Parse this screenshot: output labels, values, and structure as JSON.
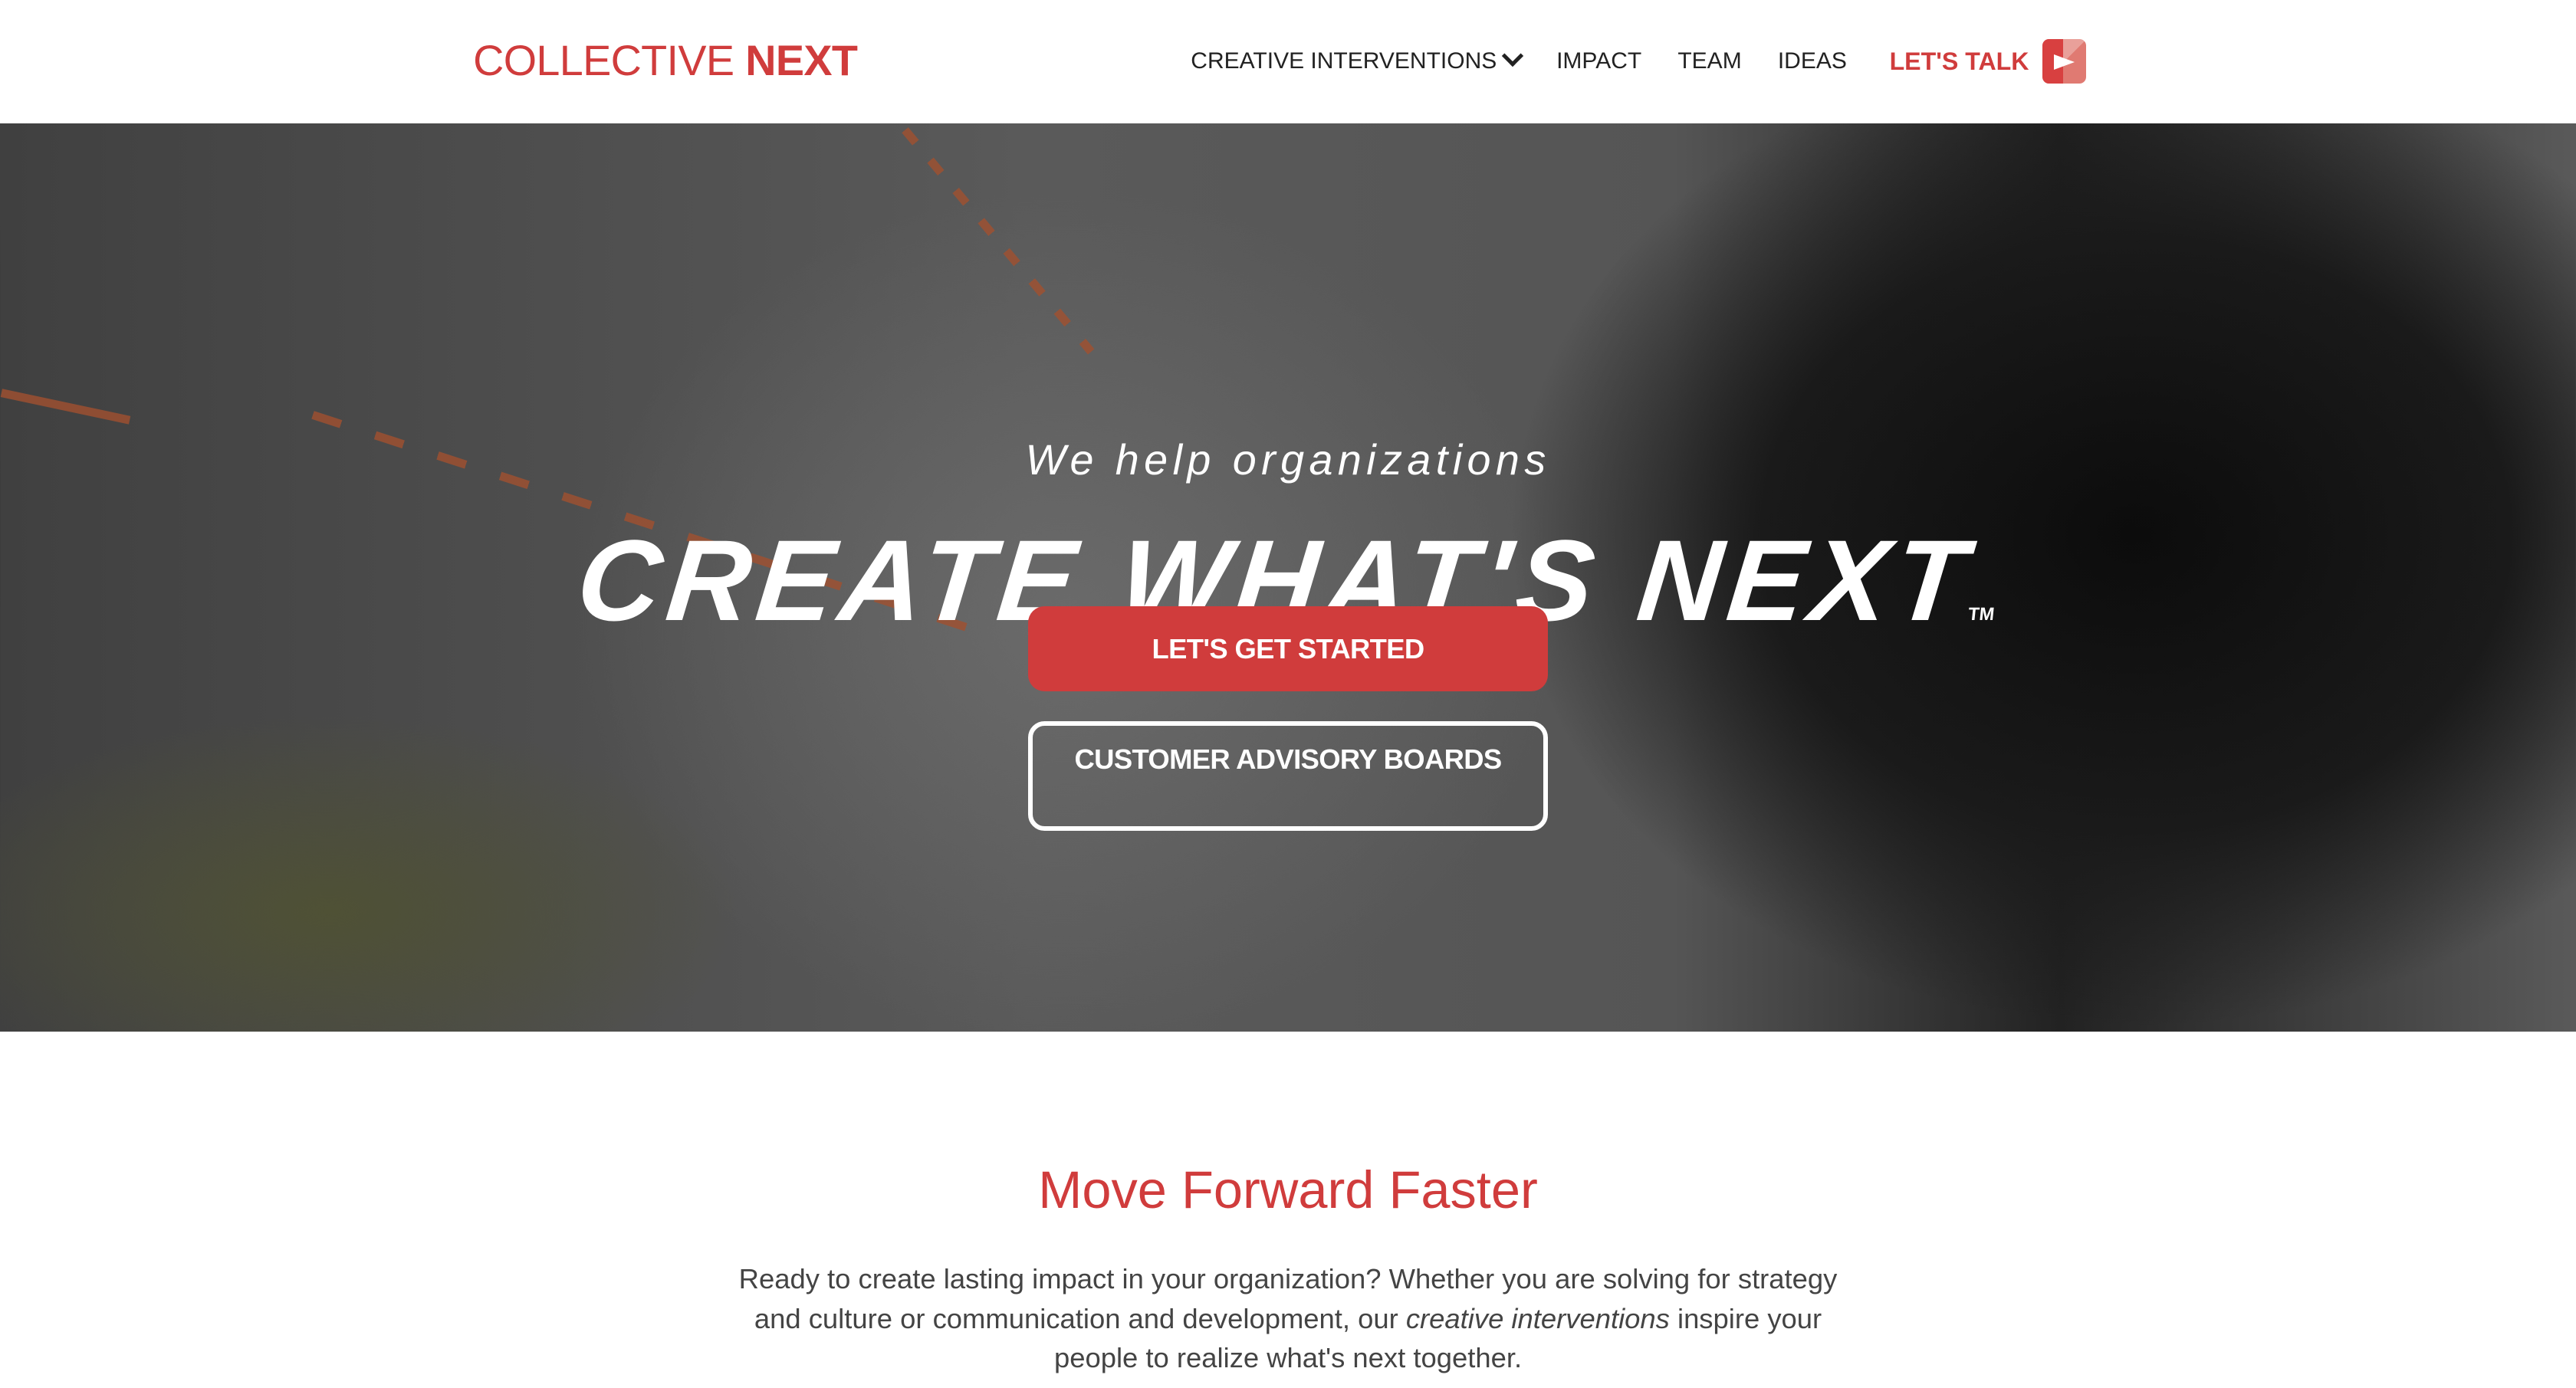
{
  "header": {
    "logo_light": "COLLECTIVE",
    "logo_bold": "NEXT",
    "nav": [
      "CREATIVE INTERVENTIONS",
      "IMPACT",
      "TEAM",
      "IDEAS"
    ],
    "cta": "LET'S TALK"
  },
  "hero": {
    "subtitle": "We help organizations",
    "title": "CREATE WHAT'S NEXT",
    "tm": "TM",
    "primary_button": "LET'S GET STARTED",
    "secondary_button": "CUSTOMER ADVISORY BOARDS"
  },
  "section": {
    "title": "Move Forward Faster",
    "body_before": "Ready to create lasting impact in your organization? Whether you are solving for strategy and culture or communication and development, our ",
    "body_em": "creative interventions",
    "body_after": " inspire your people to realize what's next together."
  },
  "colors": {
    "brand": "#d03c3c"
  }
}
